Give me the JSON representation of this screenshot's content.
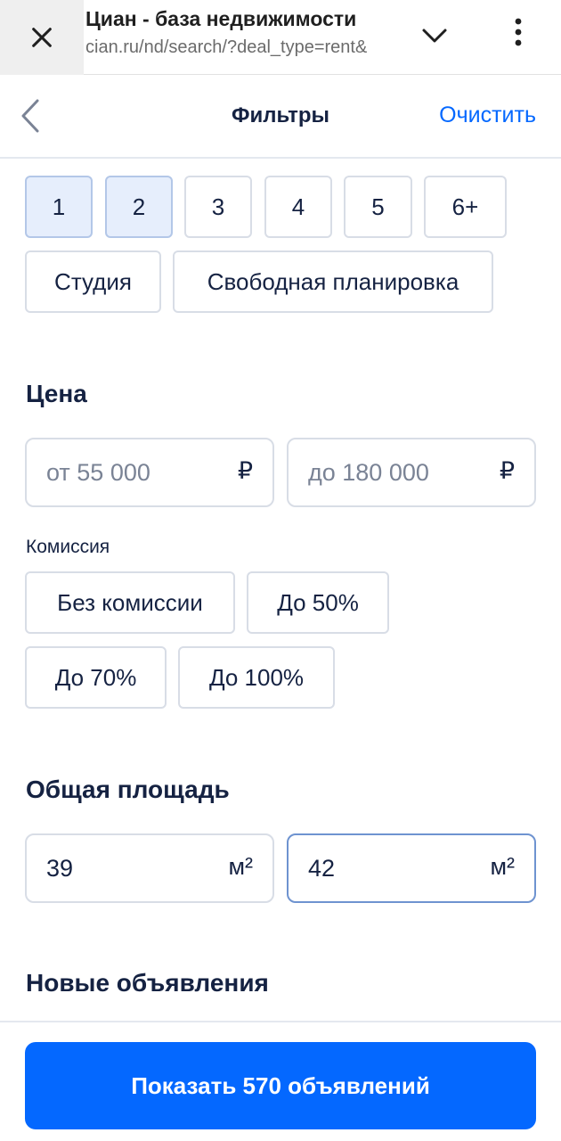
{
  "browser": {
    "title": "Циан - база недвижимости",
    "url": "cian.ru/nd/search/?deal_type=rent&"
  },
  "header": {
    "title": "Фильтры",
    "clear_label": "Очистить"
  },
  "rooms": {
    "options": [
      {
        "label": "1",
        "selected": true
      },
      {
        "label": "2",
        "selected": true
      },
      {
        "label": "3",
        "selected": false
      },
      {
        "label": "4",
        "selected": false
      },
      {
        "label": "5",
        "selected": false
      },
      {
        "label": "6+",
        "selected": false
      }
    ],
    "studio_label": "Студия",
    "free_layout_label": "Свободная планировка"
  },
  "price": {
    "title": "Цена",
    "from_placeholder": "от 55 000",
    "to_placeholder": "до 180 000",
    "currency": "₽"
  },
  "commission": {
    "label": "Комиссия",
    "options": [
      "Без комиссии",
      "До 50%",
      "До 70%",
      "До 100%"
    ]
  },
  "area": {
    "title": "Общая площадь",
    "from_value": "39",
    "to_value": "42",
    "unit": "м²"
  },
  "new_listings": {
    "title": "Новые объявления"
  },
  "footer": {
    "show_button_label": "Показать 570 объявлений"
  },
  "colors": {
    "accent": "#0468ff",
    "selected_chip_bg": "#e6eefc",
    "text": "#152242"
  }
}
